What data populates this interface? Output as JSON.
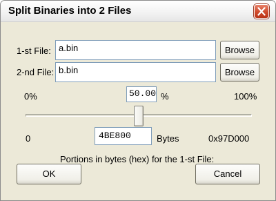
{
  "window": {
    "title": "Split Binaries into 2 Files"
  },
  "file1": {
    "label": "1-st File:",
    "value": "a.bin",
    "browse_label": "Browse"
  },
  "file2": {
    "label": "2-nd File:",
    "value": "b.bin",
    "browse_label": "Browse"
  },
  "percent": {
    "min_label": "0%",
    "value": "50.00",
    "unit": "%",
    "max_label": "100%"
  },
  "slider": {
    "position_percent": 50
  },
  "bytes": {
    "min_label": "0",
    "value": "4BE800",
    "unit": "Bytes",
    "max_label": "0x97D000"
  },
  "caption": "Portions in bytes (hex) for the 1-st File:",
  "buttons": {
    "ok": "OK",
    "cancel": "Cancel"
  }
}
